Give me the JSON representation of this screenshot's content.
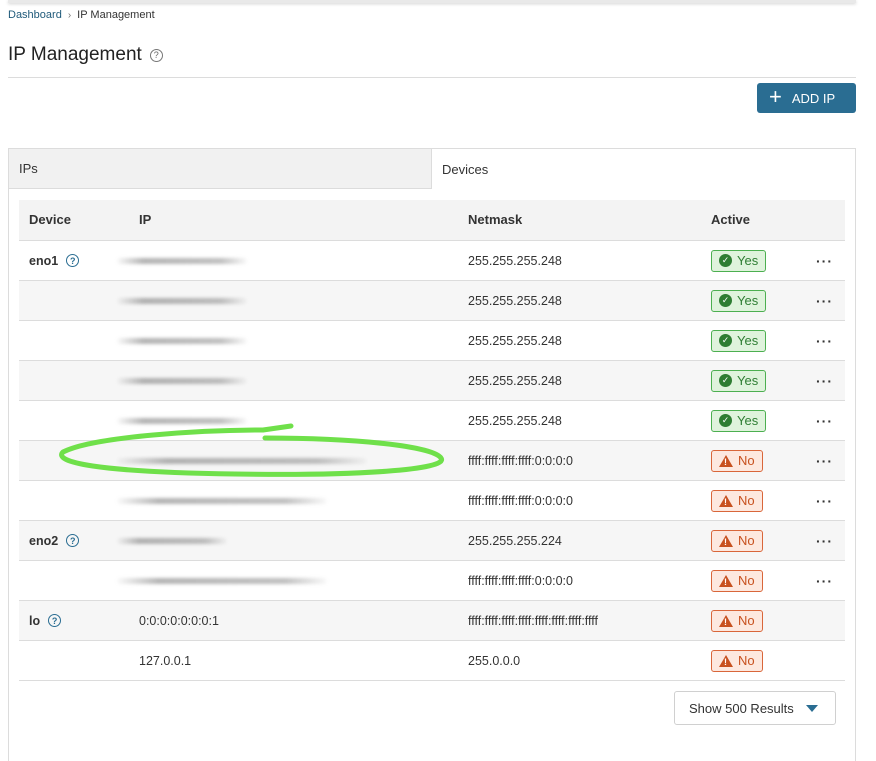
{
  "breadcrumb": {
    "items": [
      "Dashboard",
      "IP Management"
    ]
  },
  "page": {
    "title": "IP Management"
  },
  "toolbar": {
    "add_label": "ADD IP"
  },
  "tabs": [
    {
      "label": "IPs"
    },
    {
      "label": "Devices"
    }
  ],
  "table": {
    "headers": [
      "Device",
      "IP",
      "Netmask",
      "Active"
    ],
    "rows": [
      {
        "device": "eno1",
        "ip": "",
        "netmask": "255.255.255.248",
        "active": "Yes"
      },
      {
        "device": "",
        "ip": "",
        "netmask": "255.255.255.248",
        "active": "Yes"
      },
      {
        "device": "",
        "ip": "",
        "netmask": "255.255.255.248",
        "active": "Yes"
      },
      {
        "device": "",
        "ip": "",
        "netmask": "255.255.255.248",
        "active": "Yes"
      },
      {
        "device": "",
        "ip": "",
        "netmask": "255.255.255.248",
        "active": "Yes"
      },
      {
        "device": "",
        "ip": "",
        "netmask": "ffff:ffff:ffff:ffff:0:0:0:0",
        "active": "No"
      },
      {
        "device": "",
        "ip": "",
        "netmask": "ffff:ffff:ffff:ffff:0:0:0:0",
        "active": "No"
      },
      {
        "device": "eno2",
        "ip": "",
        "netmask": "255.255.255.224",
        "active": "No"
      },
      {
        "device": "",
        "ip": "",
        "netmask": "ffff:ffff:ffff:ffff:0:0:0:0",
        "active": "No"
      },
      {
        "device": "lo",
        "ip": "0:0:0:0:0:0:0:1",
        "netmask": "ffff:ffff:ffff:ffff:ffff:ffff:ffff:ffff",
        "active": "No"
      },
      {
        "device": "",
        "ip": "127.0.0.1",
        "netmask": "255.0.0.0",
        "active": "No"
      }
    ],
    "menu_glyph": "···"
  },
  "pagination": {
    "results_label": "Show 500 Results"
  },
  "colors": {
    "accent": "#2a6d92",
    "yes": "#2e7d32",
    "no": "#c8501e",
    "annotation": "#6fe04a"
  }
}
